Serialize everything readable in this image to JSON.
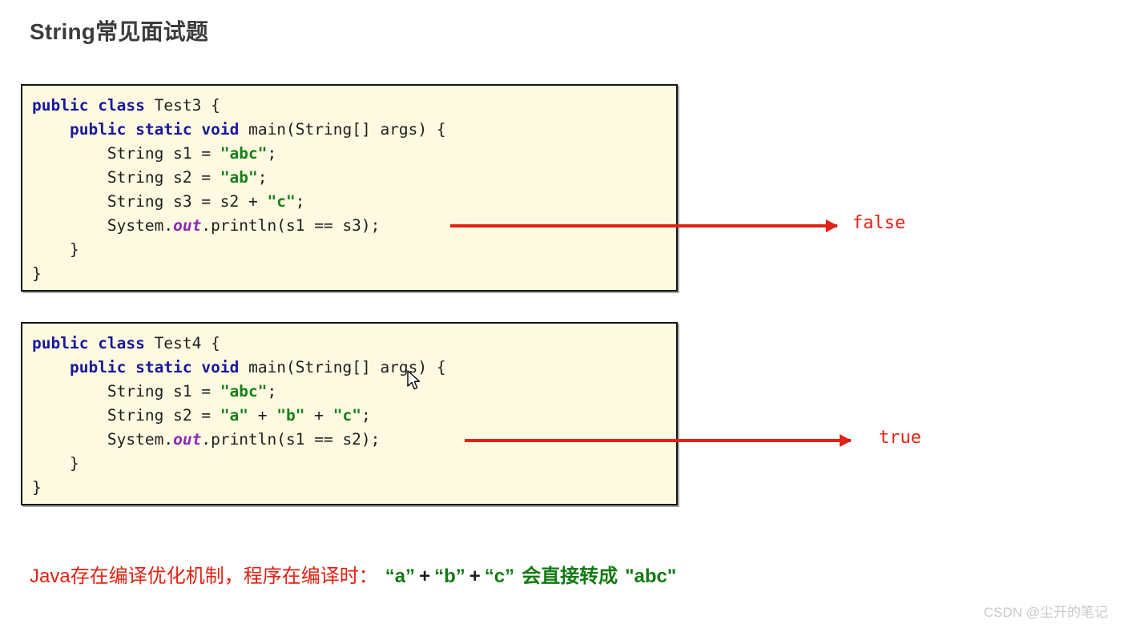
{
  "page": {
    "title": "String常见面试题",
    "background": "#ffffff"
  },
  "colors": {
    "title": "#3c3c3c",
    "code_background": "#fdfae1",
    "code_border": "#141414",
    "keyword": "#17179e",
    "string_literal": "#178017",
    "static_field": "#8e28b5",
    "plain_code": "#1d1d1d",
    "arrow": "#e32112",
    "result_text": "#e32112",
    "conclusion_red": "#e32112",
    "conclusion_green": "#127a12",
    "watermark": "#c9c9c9"
  },
  "code_box_1": {
    "lines": [
      [
        {
          "t": "public",
          "c": "kw"
        },
        {
          "t": " ",
          "c": "plain"
        },
        {
          "t": "class",
          "c": "kw"
        },
        {
          "t": " Test3 {",
          "c": "plain"
        }
      ],
      [
        {
          "t": "    ",
          "c": "plain"
        },
        {
          "t": "public",
          "c": "kw"
        },
        {
          "t": " ",
          "c": "plain"
        },
        {
          "t": "static",
          "c": "kw"
        },
        {
          "t": " ",
          "c": "plain"
        },
        {
          "t": "void",
          "c": "kw"
        },
        {
          "t": " main(String[] args) {",
          "c": "plain"
        }
      ],
      [
        {
          "t": "        String s1 = ",
          "c": "plain"
        },
        {
          "t": "\"abc\"",
          "c": "str"
        },
        {
          "t": ";",
          "c": "plain"
        }
      ],
      [
        {
          "t": "        String s2 = ",
          "c": "plain"
        },
        {
          "t": "\"ab\"",
          "c": "str"
        },
        {
          "t": ";",
          "c": "plain"
        }
      ],
      [
        {
          "t": "        String s3 = s2 + ",
          "c": "plain"
        },
        {
          "t": "\"c\"",
          "c": "str"
        },
        {
          "t": ";",
          "c": "plain"
        }
      ],
      [
        {
          "t": "        System.",
          "c": "plain"
        },
        {
          "t": "out",
          "c": "field"
        },
        {
          "t": ".println(s1 == s3);",
          "c": "plain"
        }
      ],
      [
        {
          "t": "    }",
          "c": "plain"
        }
      ],
      [
        {
          "t": "}",
          "c": "plain"
        }
      ]
    ]
  },
  "code_box_2": {
    "lines": [
      [
        {
          "t": "public",
          "c": "kw"
        },
        {
          "t": " ",
          "c": "plain"
        },
        {
          "t": "class",
          "c": "kw"
        },
        {
          "t": " Test4 {",
          "c": "plain"
        }
      ],
      [
        {
          "t": "    ",
          "c": "plain"
        },
        {
          "t": "public",
          "c": "kw"
        },
        {
          "t": " ",
          "c": "plain"
        },
        {
          "t": "static",
          "c": "kw"
        },
        {
          "t": " ",
          "c": "plain"
        },
        {
          "t": "void",
          "c": "kw"
        },
        {
          "t": " main(String[] args) {",
          "c": "plain"
        }
      ],
      [
        {
          "t": "        String s1 = ",
          "c": "plain"
        },
        {
          "t": "\"abc\"",
          "c": "str"
        },
        {
          "t": ";",
          "c": "plain"
        }
      ],
      [
        {
          "t": "        String s2 = ",
          "c": "plain"
        },
        {
          "t": "\"a\"",
          "c": "str"
        },
        {
          "t": " + ",
          "c": "plain"
        },
        {
          "t": "\"b\"",
          "c": "str"
        },
        {
          "t": " + ",
          "c": "plain"
        },
        {
          "t": "\"c\"",
          "c": "str"
        },
        {
          "t": ";",
          "c": "plain"
        }
      ],
      [
        {
          "t": "        System.",
          "c": "plain"
        },
        {
          "t": "out",
          "c": "field"
        },
        {
          "t": ".println(s1 == s2);",
          "c": "plain"
        }
      ],
      [
        {
          "t": "    }",
          "c": "plain"
        }
      ],
      [
        {
          "t": "}",
          "c": "plain"
        }
      ]
    ]
  },
  "annotations": {
    "result_1": "false",
    "result_2": "true"
  },
  "conclusion": {
    "part_red": "Java存在编译优化机制，程序在编译时：",
    "literal_a": "“a”",
    "plus_1": "+",
    "literal_b": "“b”",
    "plus_2": "+",
    "literal_c": "“c”",
    "phrase": "会直接转成",
    "result": "\"abc\""
  },
  "watermark": {
    "text": "CSDN @尘开的笔记"
  }
}
